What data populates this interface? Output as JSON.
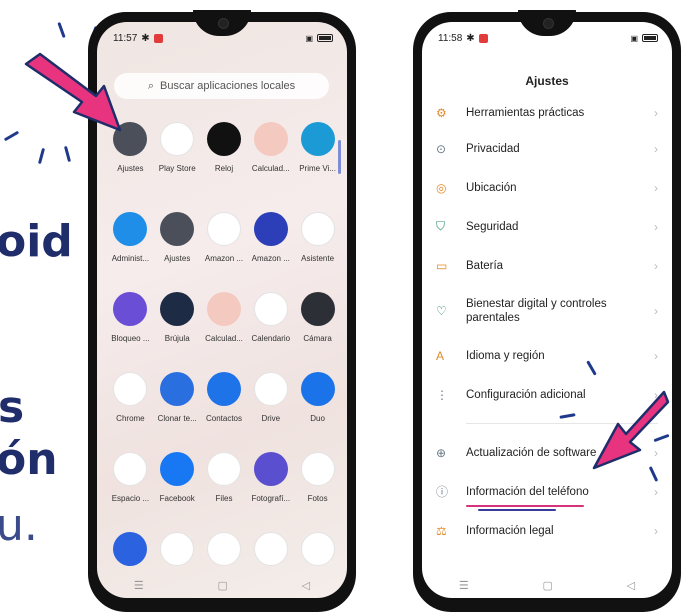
{
  "background_text": {
    "line1": "oid",
    "line2": "s",
    "line3": "ón",
    "line4": "u."
  },
  "colors": {
    "arrow": "#e8337f",
    "headline": "#1f2d6b",
    "icon_accent": "#e08a2a",
    "underline_pink": "#d6337a",
    "underline_blue": "#3b3b9e"
  },
  "phone1": {
    "time": "11:57",
    "search_placeholder": "Buscar aplicaciones locales",
    "apps": [
      [
        {
          "label": "Ajustes",
          "icon": "settings-gear-icon",
          "color": "#4a4f5a"
        },
        {
          "label": "Play Store",
          "icon": "play-store-icon",
          "color": "#ffffff"
        },
        {
          "label": "Reloj",
          "icon": "clock-icon",
          "color": "#111111"
        },
        {
          "label": "Calculad...",
          "icon": "calculator-icon",
          "color": "#f4c9c0"
        },
        {
          "label": "Prime Vi...",
          "icon": "prime-video-icon",
          "color": "#1c9ad6"
        }
      ],
      [
        {
          "label": "Administ...",
          "icon": "folder-icon",
          "color": "#1f8ee8"
        },
        {
          "label": "Ajustes",
          "icon": "settings-gear-icon",
          "color": "#4a4f5a"
        },
        {
          "label": "Amazon ...",
          "icon": "amazon-shopping-icon",
          "color": "#ffffff"
        },
        {
          "label": "Amazon ...",
          "icon": "amazon-music-icon",
          "color": "#2c3fb8"
        },
        {
          "label": "Asistente",
          "icon": "google-assistant-icon",
          "color": "#ffffff"
        }
      ],
      [
        {
          "label": "Bloqueo ...",
          "icon": "app-lock-icon",
          "color": "#6b4ed6"
        },
        {
          "label": "Brújula",
          "icon": "compass-icon",
          "color": "#1d2b44"
        },
        {
          "label": "Calculad...",
          "icon": "calculator-icon",
          "color": "#f4c9c0"
        },
        {
          "label": "Calendario",
          "icon": "calendar-icon",
          "color": "#ffffff"
        },
        {
          "label": "Cámara",
          "icon": "camera-icon",
          "color": "#2c2f36"
        }
      ],
      [
        {
          "label": "Chrome",
          "icon": "chrome-icon",
          "color": "#ffffff"
        },
        {
          "label": "Clonar te...",
          "icon": "clone-phone-icon",
          "color": "#2a6fe0"
        },
        {
          "label": "Contactos",
          "icon": "contacts-icon",
          "color": "#1e73e8"
        },
        {
          "label": "Drive",
          "icon": "drive-icon",
          "color": "#ffffff"
        },
        {
          "label": "Duo",
          "icon": "duo-icon",
          "color": "#1a73e8"
        }
      ],
      [
        {
          "label": "Espacio ...",
          "icon": "game-space-icon",
          "color": "#ffffff"
        },
        {
          "label": "Facebook",
          "icon": "facebook-icon",
          "color": "#1877f2"
        },
        {
          "label": "Files",
          "icon": "files-icon",
          "color": "#ffffff"
        },
        {
          "label": "Fotografí...",
          "icon": "photography-icon",
          "color": "#5a4fcf"
        },
        {
          "label": "Fotos",
          "icon": "google-photos-icon",
          "color": "#ffffff"
        }
      ],
      [
        {
          "label": "",
          "icon": "security-shield-icon",
          "color": "#2a62e0"
        },
        {
          "label": "",
          "icon": "gmail-icon",
          "color": "#ffffff"
        },
        {
          "label": "",
          "icon": "google-icon",
          "color": "#ffffff"
        },
        {
          "label": "",
          "icon": "google-one-icon",
          "color": "#ffffff"
        },
        {
          "label": "",
          "icon": "google-pay-icon",
          "color": "#ffffff"
        }
      ]
    ],
    "nav": [
      "☰",
      "▢",
      "◁"
    ]
  },
  "phone2": {
    "time": "11:58",
    "title": "Ajustes",
    "items": [
      {
        "label": "Herramientas prácticas",
        "icon": "tools-icon"
      },
      {
        "label": "Privacidad",
        "icon": "privacy-icon"
      },
      {
        "label": "Ubicación",
        "icon": "location-icon"
      },
      {
        "label": "Seguridad",
        "icon": "security-icon"
      },
      {
        "label": "Batería",
        "icon": "battery-icon"
      },
      {
        "label": "Bienestar digital y controles parentales",
        "icon": "wellbeing-icon"
      },
      {
        "label": "Idioma y región",
        "icon": "language-icon"
      },
      {
        "label": "Configuración adicional",
        "icon": "additional-settings-icon"
      },
      {
        "label": "Actualización de software",
        "icon": "update-icon"
      },
      {
        "label": "Información del teléfono",
        "icon": "info-icon"
      },
      {
        "label": "Información legal",
        "icon": "legal-icon"
      }
    ],
    "nav": [
      "☰",
      "▢",
      "◁"
    ]
  }
}
